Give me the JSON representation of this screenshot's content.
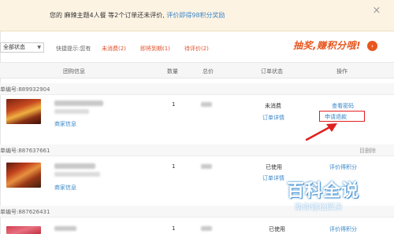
{
  "notice": {
    "message_pre": "您的 麻辣主题4人餐 等2个订单还未评价,",
    "message_link": "评价即得98积分奖励",
    "close_glyph": "×"
  },
  "filter": {
    "status_select": "全部状态",
    "hint_label": "快捷提示:您有",
    "quick_unconsumed": "未消费(2)",
    "quick_expiring": "即将到期(1)",
    "quick_to_review": "待评价(2)"
  },
  "promo": {
    "text": "抽奖,赚积分哦!",
    "arrow_glyph": "›"
  },
  "table": {
    "headers": [
      "团购信息",
      "数量",
      "总价",
      "订单状态",
      "操作"
    ]
  },
  "orders": [
    {
      "order_no": "单编号:889932904",
      "shop_label": "商家信息",
      "qty": "1",
      "status": "未消费",
      "detail_link": "订单详情",
      "op_primary": "查看密码",
      "op_secondary": "申请退款"
    },
    {
      "order_no": "单编号:887637661",
      "delete_label": "目删除",
      "shop_label": "商家信息",
      "qty": "1",
      "status": "已使用",
      "detail_link": "订单详情",
      "op_primary": "评价得积分"
    },
    {
      "order_no": "单编号:887626431",
      "qty": "1",
      "status": "已使用",
      "op_primary": "评价得积分"
    }
  ],
  "watermark": {
    "title": "百科全说",
    "subtitle": "助你轻松解决"
  },
  "colors": {
    "link_blue": "#3a87c8",
    "accent_orange": "#e8561e",
    "highlight_red": "#e02020",
    "notice_bg": "#fdf3e3"
  }
}
